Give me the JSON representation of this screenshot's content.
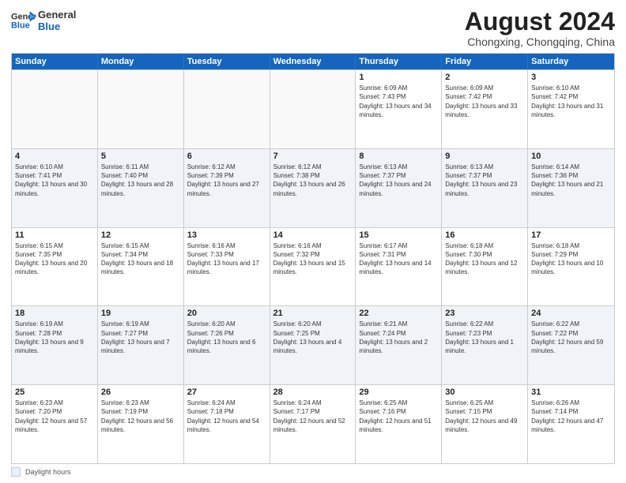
{
  "header": {
    "logo_line1": "General",
    "logo_line2": "Blue",
    "month_year": "August 2024",
    "location": "Chongxing, Chongqing, China"
  },
  "days_of_week": [
    "Sunday",
    "Monday",
    "Tuesday",
    "Wednesday",
    "Thursday",
    "Friday",
    "Saturday"
  ],
  "weeks": [
    [
      {
        "day": "",
        "info": ""
      },
      {
        "day": "",
        "info": ""
      },
      {
        "day": "",
        "info": ""
      },
      {
        "day": "",
        "info": ""
      },
      {
        "day": "1",
        "info": "Sunrise: 6:09 AM\nSunset: 7:43 PM\nDaylight: 13 hours and 34 minutes."
      },
      {
        "day": "2",
        "info": "Sunrise: 6:09 AM\nSunset: 7:42 PM\nDaylight: 13 hours and 33 minutes."
      },
      {
        "day": "3",
        "info": "Sunrise: 6:10 AM\nSunset: 7:42 PM\nDaylight: 13 hours and 31 minutes."
      }
    ],
    [
      {
        "day": "4",
        "info": "Sunrise: 6:10 AM\nSunset: 7:41 PM\nDaylight: 13 hours and 30 minutes."
      },
      {
        "day": "5",
        "info": "Sunrise: 6:11 AM\nSunset: 7:40 PM\nDaylight: 13 hours and 28 minutes."
      },
      {
        "day": "6",
        "info": "Sunrise: 6:12 AM\nSunset: 7:39 PM\nDaylight: 13 hours and 27 minutes."
      },
      {
        "day": "7",
        "info": "Sunrise: 6:12 AM\nSunset: 7:38 PM\nDaylight: 13 hours and 26 minutes."
      },
      {
        "day": "8",
        "info": "Sunrise: 6:13 AM\nSunset: 7:37 PM\nDaylight: 13 hours and 24 minutes."
      },
      {
        "day": "9",
        "info": "Sunrise: 6:13 AM\nSunset: 7:37 PM\nDaylight: 13 hours and 23 minutes."
      },
      {
        "day": "10",
        "info": "Sunrise: 6:14 AM\nSunset: 7:36 PM\nDaylight: 13 hours and 21 minutes."
      }
    ],
    [
      {
        "day": "11",
        "info": "Sunrise: 6:15 AM\nSunset: 7:35 PM\nDaylight: 13 hours and 20 minutes."
      },
      {
        "day": "12",
        "info": "Sunrise: 6:15 AM\nSunset: 7:34 PM\nDaylight: 13 hours and 18 minutes."
      },
      {
        "day": "13",
        "info": "Sunrise: 6:16 AM\nSunset: 7:33 PM\nDaylight: 13 hours and 17 minutes."
      },
      {
        "day": "14",
        "info": "Sunrise: 6:16 AM\nSunset: 7:32 PM\nDaylight: 13 hours and 15 minutes."
      },
      {
        "day": "15",
        "info": "Sunrise: 6:17 AM\nSunset: 7:31 PM\nDaylight: 13 hours and 14 minutes."
      },
      {
        "day": "16",
        "info": "Sunrise: 6:18 AM\nSunset: 7:30 PM\nDaylight: 13 hours and 12 minutes."
      },
      {
        "day": "17",
        "info": "Sunrise: 6:18 AM\nSunset: 7:29 PM\nDaylight: 13 hours and 10 minutes."
      }
    ],
    [
      {
        "day": "18",
        "info": "Sunrise: 6:19 AM\nSunset: 7:28 PM\nDaylight: 13 hours and 9 minutes."
      },
      {
        "day": "19",
        "info": "Sunrise: 6:19 AM\nSunset: 7:27 PM\nDaylight: 13 hours and 7 minutes."
      },
      {
        "day": "20",
        "info": "Sunrise: 6:20 AM\nSunset: 7:26 PM\nDaylight: 13 hours and 6 minutes."
      },
      {
        "day": "21",
        "info": "Sunrise: 6:20 AM\nSunset: 7:25 PM\nDaylight: 13 hours and 4 minutes."
      },
      {
        "day": "22",
        "info": "Sunrise: 6:21 AM\nSunset: 7:24 PM\nDaylight: 13 hours and 2 minutes."
      },
      {
        "day": "23",
        "info": "Sunrise: 6:22 AM\nSunset: 7:23 PM\nDaylight: 13 hours and 1 minute."
      },
      {
        "day": "24",
        "info": "Sunrise: 6:22 AM\nSunset: 7:22 PM\nDaylight: 12 hours and 59 minutes."
      }
    ],
    [
      {
        "day": "25",
        "info": "Sunrise: 6:23 AM\nSunset: 7:20 PM\nDaylight: 12 hours and 57 minutes."
      },
      {
        "day": "26",
        "info": "Sunrise: 6:23 AM\nSunset: 7:19 PM\nDaylight: 12 hours and 56 minutes."
      },
      {
        "day": "27",
        "info": "Sunrise: 6:24 AM\nSunset: 7:18 PM\nDaylight: 12 hours and 54 minutes."
      },
      {
        "day": "28",
        "info": "Sunrise: 6:24 AM\nSunset: 7:17 PM\nDaylight: 12 hours and 52 minutes."
      },
      {
        "day": "29",
        "info": "Sunrise: 6:25 AM\nSunset: 7:16 PM\nDaylight: 12 hours and 51 minutes."
      },
      {
        "day": "30",
        "info": "Sunrise: 6:25 AM\nSunset: 7:15 PM\nDaylight: 12 hours and 49 minutes."
      },
      {
        "day": "31",
        "info": "Sunrise: 6:26 AM\nSunset: 7:14 PM\nDaylight: 12 hours and 47 minutes."
      }
    ]
  ],
  "footer": {
    "legend_label": "Daylight hours"
  }
}
